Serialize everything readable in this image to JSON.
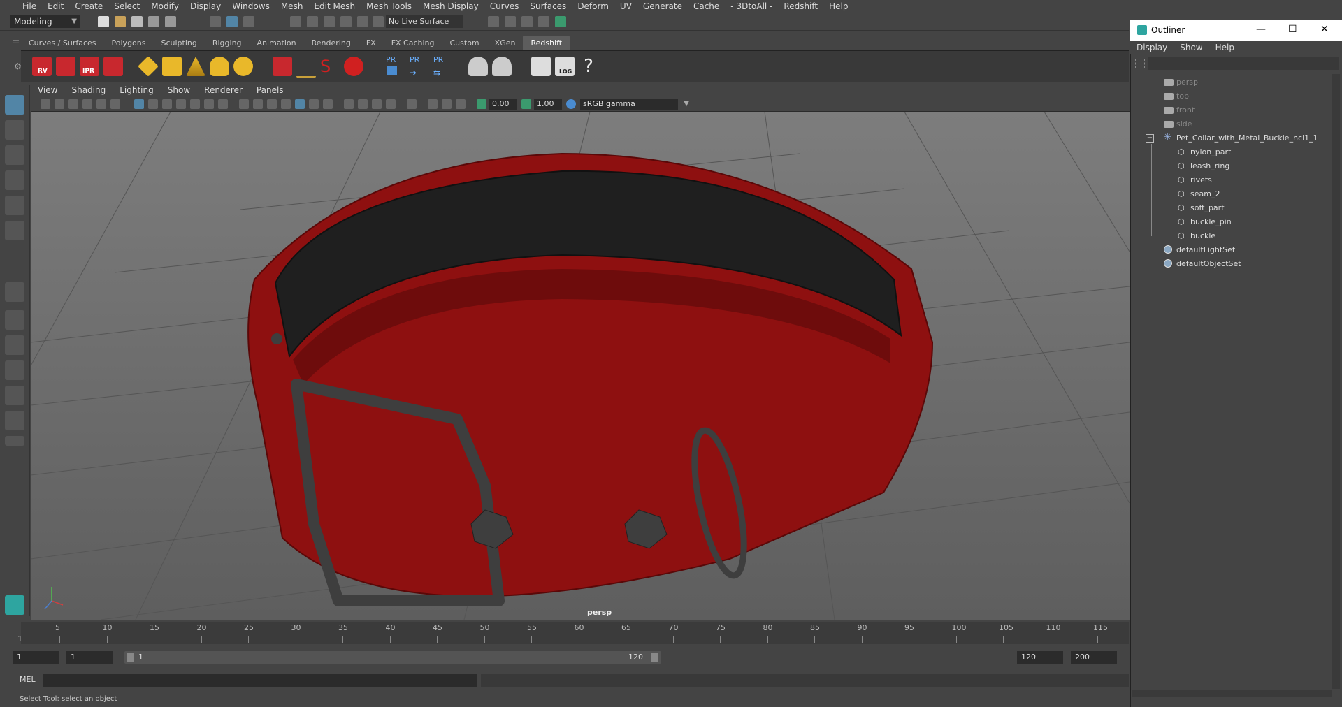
{
  "menubar": [
    "File",
    "Edit",
    "Create",
    "Select",
    "Modify",
    "Display",
    "Windows",
    "Mesh",
    "Edit Mesh",
    "Mesh Tools",
    "Mesh Display",
    "Curves",
    "Surfaces",
    "Deform",
    "UV",
    "Generate",
    "Cache",
    "- 3DtoAll -",
    "Redshift",
    "Help"
  ],
  "status": {
    "mode": "Modeling",
    "live_surface": "No Live Surface"
  },
  "shelf_tabs": [
    "Curves / Surfaces",
    "Polygons",
    "Sculpting",
    "Rigging",
    "Animation",
    "Rendering",
    "FX",
    "FX Caching",
    "Custom",
    "XGen",
    "Redshift"
  ],
  "shelf_active_tab": "Redshift",
  "shelf_labels": {
    "rv": "RV",
    "ipr": "IPR",
    "pr1": "PR",
    "pr2": "PR",
    "pr3": "PR",
    "log": "LOG",
    "help": "?"
  },
  "panel_menu": [
    "View",
    "Shading",
    "Lighting",
    "Show",
    "Renderer",
    "Panels"
  ],
  "panel_bar": {
    "exposure": "0.00",
    "gamma_value": "1.00",
    "color_space": "sRGB gamma"
  },
  "viewport": {
    "camera_label": "persp"
  },
  "timeline": {
    "ticks": [
      "5",
      "10",
      "15",
      "20",
      "25",
      "30",
      "35",
      "40",
      "45",
      "50",
      "55",
      "60",
      "65",
      "70",
      "75",
      "80",
      "85",
      "90",
      "95",
      "100",
      "105",
      "110",
      "115"
    ],
    "current": "1"
  },
  "range": {
    "start": "1",
    "start2": "1",
    "slider_start": "1",
    "slider_end": "120",
    "end": "120",
    "end2": "200"
  },
  "cmd": {
    "label": "MEL"
  },
  "help_line": "Select Tool: select an object",
  "outliner": {
    "title": "Outliner",
    "menu": [
      "Display",
      "Show",
      "Help"
    ],
    "items": [
      {
        "label": "persp",
        "type": "camera"
      },
      {
        "label": "top",
        "type": "camera"
      },
      {
        "label": "front",
        "type": "camera"
      },
      {
        "label": "side",
        "type": "camera"
      },
      {
        "label": "Pet_Collar_with_Metal_Buckle_ncl1_1",
        "type": "group"
      },
      {
        "label": "nylon_part",
        "type": "mesh"
      },
      {
        "label": "leash_ring",
        "type": "mesh"
      },
      {
        "label": "rivets",
        "type": "mesh"
      },
      {
        "label": "seam_2",
        "type": "mesh"
      },
      {
        "label": "soft_part",
        "type": "mesh"
      },
      {
        "label": "buckle_pin",
        "type": "mesh"
      },
      {
        "label": "buckle",
        "type": "mesh"
      },
      {
        "label": "defaultLightSet",
        "type": "set"
      },
      {
        "label": "defaultObjectSet",
        "type": "set"
      }
    ]
  },
  "colors": {
    "accent": "#5285a6",
    "collar_red": "#8e1010",
    "collar_inner": "#1f1f1f",
    "metal": "#3e3e3e"
  }
}
